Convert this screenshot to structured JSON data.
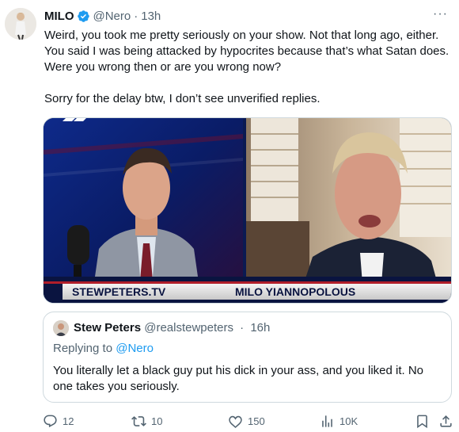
{
  "tweet": {
    "author_name": "MILO",
    "handle": "@Nero",
    "separator": "·",
    "time": "13h",
    "more_label": "···",
    "text": "Weird, you took me pretty seriously on your show. Not that long ago, either. You said I was being attacked by hypocrites because that’s what Satan does. Were you wrong then or are you wrong now?\n\nSorry for the delay btw, I don’t see unverified replies."
  },
  "media": {
    "left_caption": "STEWPETERS.TV",
    "right_caption": "MILO YIANNOPOLOUS"
  },
  "quote": {
    "author_name": "Stew Peters",
    "handle": "@realstewpeters",
    "separator": "·",
    "time": "16h",
    "replying_prefix": "Replying to",
    "replying_handle": "@Nero",
    "text": "You literally let a black guy put his dick in your ass, and you liked it. No one takes you seriously."
  },
  "actions": {
    "replies": "12",
    "retweets": "10",
    "likes": "150",
    "views": "10K"
  },
  "icons": {
    "verified": "verified-badge-icon",
    "reply": "reply-icon",
    "retweet": "retweet-icon",
    "like": "heart-icon",
    "views": "views-bar-chart-icon",
    "bookmark": "bookmark-icon"
  },
  "colors": {
    "text": "#0f1419",
    "secondary": "#536471",
    "accent": "#1d9bf0",
    "border": "#cfd9de"
  }
}
